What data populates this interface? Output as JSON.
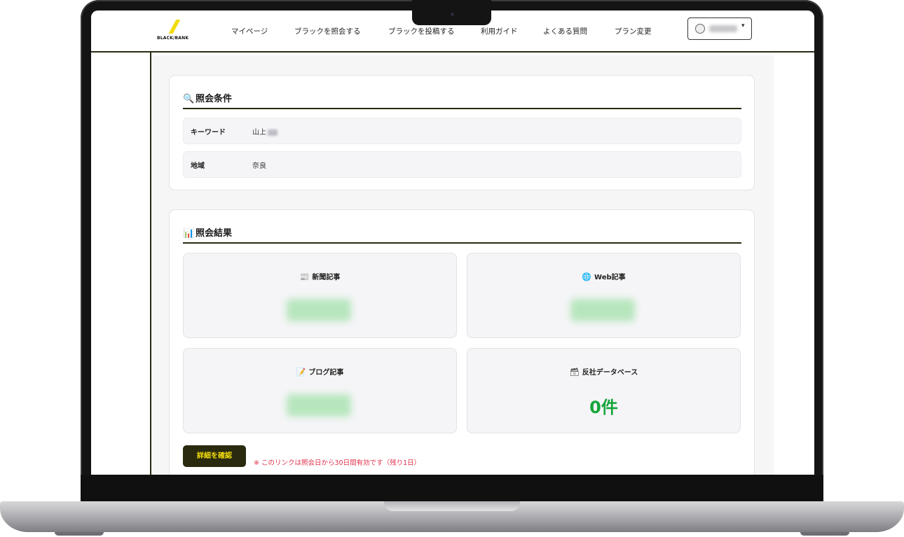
{
  "header": {
    "logo_text": "BLACK/BANK",
    "nav": [
      "マイページ",
      "ブラックを照会する",
      "ブラックを投稿する",
      "利用ガイド",
      "よくある質問",
      "プラン変更"
    ],
    "user_caret": "▾"
  },
  "conditions": {
    "title": "照会条件",
    "title_icon": "🔍",
    "rows": [
      {
        "label": "キーワード",
        "value": "山上"
      },
      {
        "label": "地域",
        "value": "奈良"
      }
    ]
  },
  "results": {
    "title": "照会結果",
    "title_icon": "📊",
    "tiles": [
      {
        "icon": "📰",
        "label": "新聞記事"
      },
      {
        "icon": "🌐",
        "label": "Web記事"
      },
      {
        "icon": "📝",
        "label": "ブログ記事"
      },
      {
        "icon": "🗃",
        "label": "反社データベース",
        "count": "0件"
      }
    ]
  },
  "actions": {
    "detail_button": "詳細を確認",
    "notice": "※ このリンクは照会日から30日間有効です（残り1日）"
  },
  "colors": {
    "accent_yellow": "#f2dc0b",
    "dark_olive": "#2a2a0f",
    "count_green": "#17a53b",
    "notice_red": "#e0314b"
  }
}
